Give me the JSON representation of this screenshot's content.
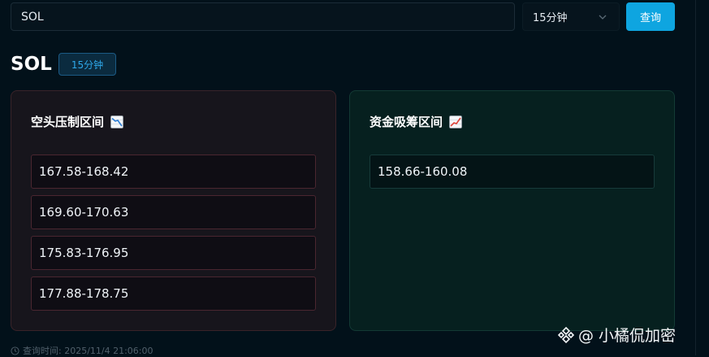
{
  "search": {
    "value": "SOL"
  },
  "interval_select": {
    "selected": "15分钟"
  },
  "query_button": {
    "label": "查询"
  },
  "header": {
    "symbol": "SOL",
    "interval_badge": "15分钟"
  },
  "short_card": {
    "title": "空头压制区间",
    "icon": "chart-decreasing-icon",
    "zones": [
      "167.58-168.42",
      "169.60-170.63",
      "175.83-176.95",
      "177.88-178.75"
    ]
  },
  "accum_card": {
    "title": "资金吸筹区间",
    "icon": "chart-increasing-icon",
    "zones": [
      "158.66-160.08"
    ]
  },
  "footer": {
    "query_time": "查询时间: 2025/11/4 21:06:00"
  },
  "watermark": {
    "text": "@ 小橘侃加密",
    "icon": "binance-square-icon"
  },
  "colors": {
    "accent": "#0ea5e0",
    "background": "#02111a",
    "short_border": "#4a2630",
    "accum_border": "#173b3a"
  }
}
